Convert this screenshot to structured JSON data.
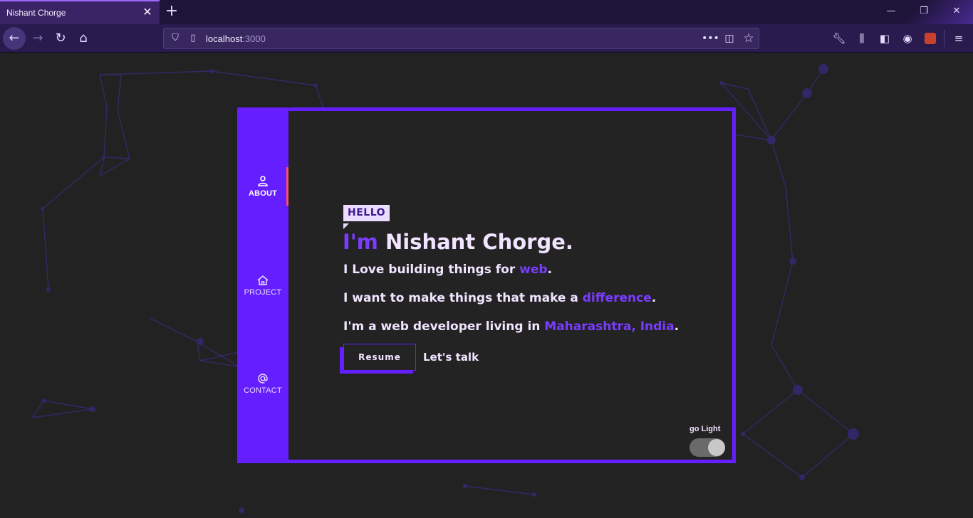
{
  "browser": {
    "tab_title": "Nishant Chorge",
    "tab_close": "✕",
    "new_tab": "+",
    "window": {
      "minimize": "—",
      "restore": "❐",
      "close": "✕"
    },
    "url_host": "localhost",
    "url_port": ":3000",
    "icons": [
      "back-icon",
      "forward-icon",
      "reload-icon",
      "home-icon",
      "shield-icon",
      "page-icon",
      "more-icon",
      "pocket-icon",
      "star-icon",
      "wrench-icon",
      "library-icon",
      "sidebar-icon",
      "account-icon",
      "extension-icon",
      "menu-icon"
    ]
  },
  "sidebar": {
    "items": [
      {
        "label": "ABOUT",
        "icon": "person-icon",
        "active": true
      },
      {
        "label": "PROJECT",
        "icon": "home-icon",
        "active": false
      },
      {
        "label": "CONTACT",
        "icon": "at-icon",
        "active": false
      }
    ]
  },
  "hero": {
    "hello": "HELLO",
    "greeting_prefix": "I'm",
    "name": "Nishant Chorge.",
    "line1": {
      "before": "I Love building things for ",
      "highlight": "web",
      "after": "."
    },
    "line2": {
      "before": "I want to make things that make a ",
      "highlight": "difference",
      "after": "."
    },
    "line3": {
      "before": "I'm a web developer living in ",
      "highlight": "Maharashtra, India",
      "after": "."
    },
    "resume_label": "Resume",
    "talk_label": "Let's talk"
  },
  "theme_toggle": {
    "label": "go Light",
    "on": true
  },
  "colors": {
    "accent": "#651fff",
    "highlight": "#7a3cff",
    "active_marker": "#ff4d6d",
    "background": "#222222",
    "text": "#f0e4ff"
  }
}
